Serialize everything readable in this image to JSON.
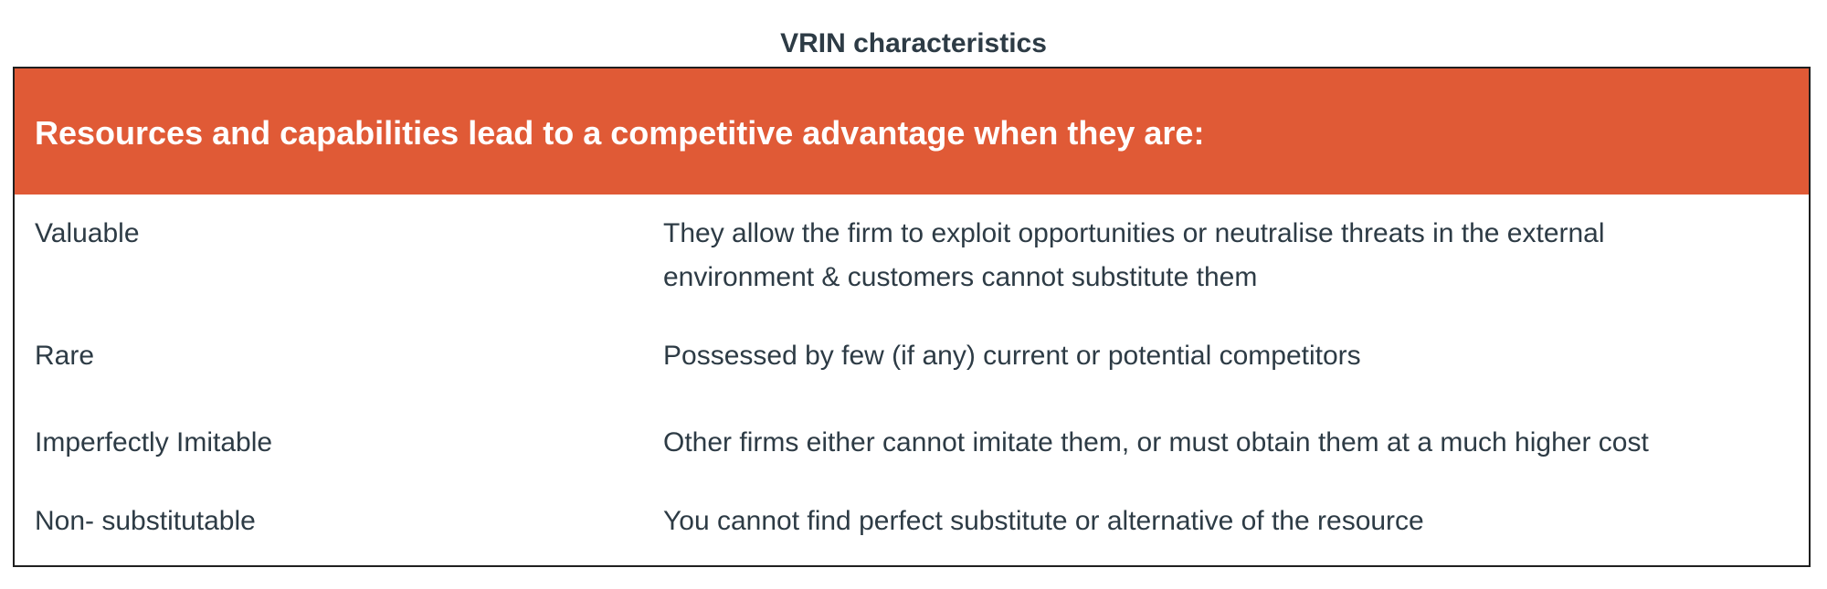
{
  "caption": "VRIN characteristics",
  "table": {
    "header": "Resources and capabilities lead to a competitive advantage when they are:",
    "rows": [
      {
        "term": "Valuable",
        "definition": "They allow the firm to exploit opportunities or neutralise threats in the external environment & customers cannot substitute them"
      },
      {
        "term": "Rare",
        "definition": "Possessed by few (if any) current or potential competitors"
      },
      {
        "term": "Imperfectly Imitable",
        "definition": "Other firms either cannot imitate them, or must obtain them at a much higher cost"
      },
      {
        "term": "Non- substitutable",
        "definition": "You cannot find perfect substitute or alternative of the resource"
      }
    ]
  },
  "colors": {
    "header_background": "#e05a36",
    "header_text": "#ffffff",
    "body_text": "#2d3b45",
    "border": "#1f1f1f"
  }
}
